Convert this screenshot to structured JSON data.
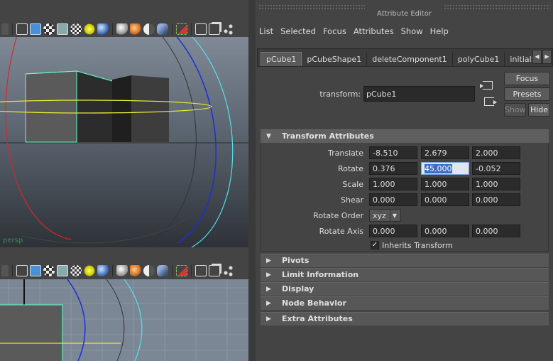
{
  "editor": {
    "title": "Attribute Editor",
    "menu": [
      "List",
      "Selected",
      "Focus",
      "Attributes",
      "Show",
      "Help"
    ],
    "tabs": [
      "pCube1",
      "pCubeShape1",
      "deleteComponent1",
      "polyCube1",
      "initialS"
    ],
    "transform_label": "transform:",
    "transform_value": "pCube1",
    "buttons": {
      "focus": "Focus",
      "presets": "Presets",
      "show": "Show",
      "hide": "Hide"
    }
  },
  "transform_attributes": {
    "header": "Transform Attributes",
    "rows": [
      {
        "label": "Translate",
        "values": [
          "-8.510",
          "2.679",
          "2.000"
        ]
      },
      {
        "label": "Rotate",
        "values": [
          "0.376",
          "45.000",
          "-0.052"
        ]
      },
      {
        "label": "Scale",
        "values": [
          "1.000",
          "1.000",
          "1.000"
        ]
      },
      {
        "label": "Shear",
        "values": [
          "0.000",
          "0.000",
          "0.000"
        ]
      }
    ],
    "rotate_order_label": "Rotate Order",
    "rotate_order_value": "xyz",
    "rotate_axis_label": "Rotate Axis",
    "rotate_axis_values": [
      "0.000",
      "0.000",
      "0.000"
    ],
    "inherits_label": "Inherits Transform",
    "inherits_checked": true
  },
  "collapsed_sections": [
    "Pivots",
    "Limit Information",
    "Display",
    "Node Behavior",
    "Extra Attributes"
  ],
  "viewport": {
    "persp_label": "persp",
    "toolbar_icons": [
      "wire-cube-icon",
      "shaded-cube-icon",
      "checker-icon",
      "wire-shaded-icon",
      "xray-icon",
      "light-icon",
      "sphere-icon",
      "sphere-white-icon",
      "sphere-orange-icon",
      "half-sphere-icon",
      "cylinder-icon",
      "select-icon",
      "cube-icon",
      "multi-icon",
      "share-icon"
    ]
  }
}
